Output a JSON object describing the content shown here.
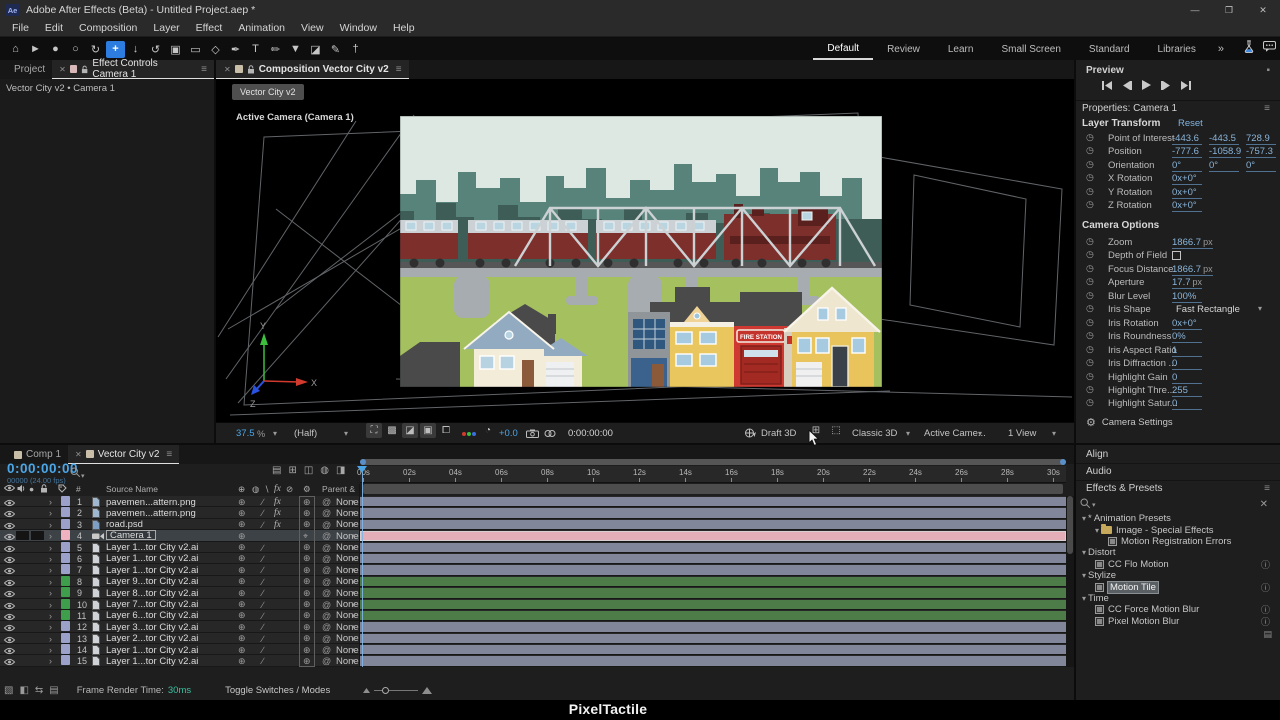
{
  "titlebar": {
    "app_icon": "Ae",
    "title": "Adobe After Effects (Beta) - Untitled Project.aep *",
    "minimize": "—",
    "restore": "❐",
    "close": "✕"
  },
  "menubar": {
    "items": [
      "File",
      "Edit",
      "Composition",
      "Layer",
      "Effect",
      "Animation",
      "View",
      "Window",
      "Help"
    ]
  },
  "toolbar": {
    "tools": [
      {
        "name": "home-tool",
        "glyph": "⌂"
      },
      {
        "name": "selection-tool",
        "glyph": "►"
      },
      {
        "name": "hand-tool",
        "glyph": "●"
      },
      {
        "name": "zoom-tool",
        "glyph": "○"
      },
      {
        "name": "orbit-camera-tool",
        "glyph": "↻"
      },
      {
        "name": "pan-camera-tool",
        "glyph": "+",
        "active": true
      },
      {
        "name": "dolly-camera-tool",
        "glyph": "↓"
      },
      {
        "name": "rotation-tool",
        "glyph": "↺"
      },
      {
        "name": "camera-tool",
        "glyph": "▣"
      },
      {
        "name": "rectangle-tool",
        "glyph": "▭"
      },
      {
        "name": "shape-tool",
        "glyph": "◇"
      },
      {
        "name": "pen-tool",
        "glyph": "✒"
      },
      {
        "name": "type-tool",
        "glyph": "T"
      },
      {
        "name": "brush-tool",
        "glyph": "✏"
      },
      {
        "name": "clone-stamp-tool",
        "glyph": "▼"
      },
      {
        "name": "eraser-tool",
        "glyph": "◪"
      },
      {
        "name": "roto-brush-tool",
        "glyph": "✎"
      },
      {
        "name": "puppet-pin-tool",
        "glyph": "†"
      }
    ]
  },
  "workspaces": {
    "tabs": [
      {
        "label": "Default",
        "active": true
      },
      {
        "label": "Review"
      },
      {
        "label": "Learn"
      },
      {
        "label": "Small Screen"
      },
      {
        "label": "Standard"
      },
      {
        "label": "Libraries"
      }
    ],
    "overflow": "»"
  },
  "left_panel": {
    "tab_project": "Project",
    "tab_effect_controls": "Effect Controls Camera 1",
    "breadcrumb": "Vector City v2 • Camera 1"
  },
  "viewer": {
    "tab": "Composition Vector City v2",
    "comp_chip": "Vector City v2",
    "camera_label": "Active Camera (Camera 1)",
    "zoom": "37.5",
    "zoom_unit": "%",
    "resolution": "(Half)",
    "exposure": "+0.0",
    "timecode": "0:00:00:00",
    "draft_3d": "Draft 3D",
    "renderer": "Classic 3D",
    "camera_view": "Active Came...",
    "view_layout": "1 View",
    "gizmo": {
      "x": "X",
      "y": "Y",
      "z": "Z"
    }
  },
  "scene": {
    "fire_station_sign": "FIRE STATION"
  },
  "preview": {
    "title": "Preview"
  },
  "properties": {
    "title": "Properties: Camera 1",
    "section": "Layer Transform",
    "reset": "Reset",
    "rows": [
      {
        "label": "Point of Interest",
        "values": [
          "-443.6",
          "-443.5",
          "728.9"
        ]
      },
      {
        "label": "Position",
        "values": [
          "-777.6",
          "-1058.9",
          "-757.3"
        ]
      },
      {
        "label": "Orientation",
        "values": [
          "0°",
          "0°",
          "0°"
        ]
      },
      {
        "label": "X Rotation",
        "values": [
          "0x+0°"
        ]
      },
      {
        "label": "Y Rotation",
        "values": [
          "0x+0°"
        ]
      },
      {
        "label": "Z Rotation",
        "values": [
          "0x+0°"
        ]
      }
    ]
  },
  "camera_options": {
    "title": "Camera Options",
    "rows": [
      {
        "label": "Zoom",
        "value": "1866.7",
        "unit": "px"
      },
      {
        "label": "Depth of Field",
        "type": "checkbox"
      },
      {
        "label": "Focus Distance",
        "value": "1866.7",
        "unit": "px"
      },
      {
        "label": "Aperture",
        "value": "17.7",
        "unit": "px"
      },
      {
        "label": "Blur Level",
        "value": "100%"
      },
      {
        "label": "Iris Shape",
        "value": "Fast Rectangle",
        "type": "dropdown"
      },
      {
        "label": "Iris Rotation",
        "value": "0x+0°"
      },
      {
        "label": "Iris Roundness",
        "value": "0%"
      },
      {
        "label": "Iris Aspect Ratio",
        "value": "1"
      },
      {
        "label": "Iris Diffraction ...",
        "value": "0"
      },
      {
        "label": "Highlight Gain",
        "value": "0"
      },
      {
        "label": "Highlight Thre...",
        "value": "255"
      },
      {
        "label": "Highlight Satur...",
        "value": "0"
      }
    ],
    "footer": "Camera Settings"
  },
  "side_panels": {
    "align": "Align",
    "audio": "Audio"
  },
  "effects_presets": {
    "title": "Effects & Presets",
    "tree": [
      {
        "label": "* Animation Presets",
        "level": 0,
        "kind": "category"
      },
      {
        "label": "Image - Special Effects",
        "level": 1,
        "kind": "folder"
      },
      {
        "label": "Motion Registration Errors",
        "level": 2,
        "kind": "preset"
      },
      {
        "label": "Distort",
        "level": 0,
        "kind": "category"
      },
      {
        "label": "CC Flo Motion",
        "level": 1,
        "kind": "effect",
        "info": true
      },
      {
        "label": "Stylize",
        "level": 0,
        "kind": "category"
      },
      {
        "label": "Motion Tile",
        "level": 1,
        "kind": "effect",
        "info": true,
        "selected": true
      },
      {
        "label": "Time",
        "level": 0,
        "kind": "category"
      },
      {
        "label": "CC Force Motion Blur",
        "level": 1,
        "kind": "effect",
        "info": true
      },
      {
        "label": "Pixel Motion Blur",
        "level": 1,
        "kind": "effect",
        "info": true
      }
    ]
  },
  "timeline": {
    "tabs": [
      {
        "label": "Comp 1",
        "active": false
      },
      {
        "label": "Vector City v2",
        "active": true
      }
    ],
    "timecode": "0:00:00:00",
    "frame_info": "00000 (24.00 fps)",
    "hash_column": "#",
    "source_name": "Source Name",
    "parent_link": "Parent & Link",
    "parent_value": "None",
    "ruler_ticks": [
      "00s",
      "02s",
      "04s",
      "06s",
      "08s",
      "10s",
      "12s",
      "14s",
      "16s",
      "18s",
      "20s",
      "22s",
      "24s",
      "26s",
      "28s",
      "30s"
    ],
    "label_colors": {
      "lavender": "#9ca1c9",
      "green": "#3f9e4b",
      "pink": "#eeb2c0"
    },
    "bar_colors": {
      "lavender": "#82869b",
      "green": "#4d7c49",
      "pink": "#e3aeb8"
    },
    "layers": [
      {
        "num": "1",
        "name": "pavemen...attern.png",
        "type": "png",
        "color": "lavender",
        "fx": true
      },
      {
        "num": "2",
        "name": "pavemen...attern.png",
        "type": "png",
        "color": "lavender",
        "fx": true
      },
      {
        "num": "3",
        "name": "road.psd",
        "type": "psd",
        "color": "lavender",
        "fx": true
      },
      {
        "num": "4",
        "name": "Camera 1",
        "type": "camera",
        "color": "pink",
        "selected": true
      },
      {
        "num": "5",
        "name": "Layer 1...tor City v2.ai",
        "type": "ai",
        "color": "lavender"
      },
      {
        "num": "6",
        "name": "Layer 1...tor City v2.ai",
        "type": "ai",
        "color": "lavender"
      },
      {
        "num": "7",
        "name": "Layer 1...tor City v2.ai",
        "type": "ai",
        "color": "lavender"
      },
      {
        "num": "8",
        "name": "Layer 9...tor City v2.ai",
        "type": "ai",
        "color": "green"
      },
      {
        "num": "9",
        "name": "Layer 8...tor City v2.ai",
        "type": "ai",
        "color": "green"
      },
      {
        "num": "10",
        "name": "Layer 7...tor City v2.ai",
        "type": "ai",
        "color": "green"
      },
      {
        "num": "11",
        "name": "Layer 6...tor City v2.ai",
        "type": "ai",
        "color": "green"
      },
      {
        "num": "12",
        "name": "Layer 3...tor City v2.ai",
        "type": "ai",
        "color": "lavender"
      },
      {
        "num": "13",
        "name": "Layer 2...tor City v2.ai",
        "type": "ai",
        "color": "lavender"
      },
      {
        "num": "14",
        "name": "Layer 1...tor City v2.ai",
        "type": "ai",
        "color": "lavender"
      },
      {
        "num": "15",
        "name": "Layer 1...tor City v2.ai",
        "type": "ai",
        "color": "lavender"
      }
    ]
  },
  "bottom_bar": {
    "render_label": "Frame Render Time:",
    "render_value": "30ms",
    "toggle_label": "Toggle Switches / Modes"
  },
  "watermark": "PixelTactile"
}
